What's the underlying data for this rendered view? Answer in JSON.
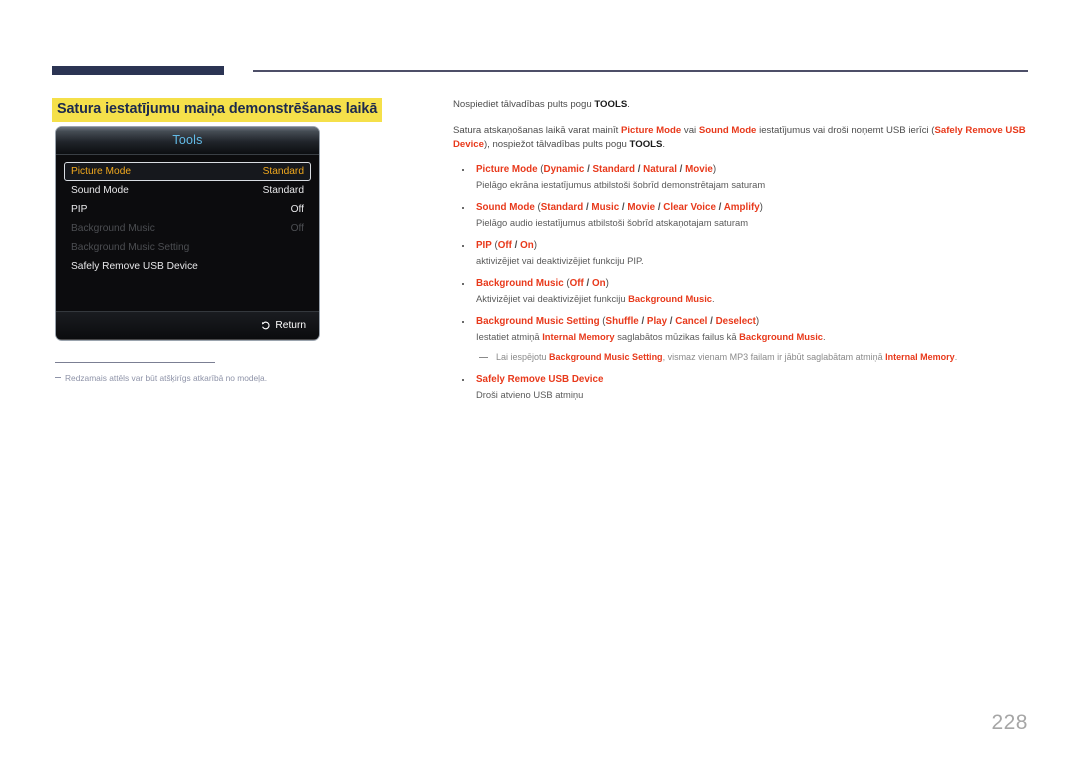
{
  "page": {
    "number": "228"
  },
  "section": {
    "title": "Satura iestatījumu maiņa demonstrēšanas laikā"
  },
  "osd": {
    "title": "Tools",
    "rows": [
      {
        "label": "Picture Mode",
        "value": "Standard",
        "state": "selected"
      },
      {
        "label": "Sound Mode",
        "value": "Standard",
        "state": "normal"
      },
      {
        "label": "PIP",
        "value": "Off",
        "state": "normal"
      },
      {
        "label": "Background Music",
        "value": "Off",
        "state": "disabled"
      },
      {
        "label": "Background Music Setting",
        "value": "",
        "state": "disabled"
      },
      {
        "label": "Safely Remove USB Device",
        "value": "",
        "state": "normal"
      }
    ],
    "return_label": "Return",
    "return_icon": "return-arrow-icon"
  },
  "footnote": {
    "text": "Redzamais attēls var būt atšķirīgs atkarībā no modeļa."
  },
  "body": {
    "paragraph1": {
      "pre": "Nospiediet tālvadības pults pogu ",
      "bold1": "TOOLS",
      "post": "."
    },
    "paragraph2": {
      "p1": "Satura atskaņošanas laikā varat mainīt ",
      "kw1": "Picture Mode",
      "p2": " vai ",
      "kw2": "Sound Mode",
      "p3": " iestatījumus vai droši noņemt USB ierīci (",
      "kw3": "Safely Remove USB Device",
      "p4": "), nospiežot tālvadības pults pogu ",
      "bold1": "TOOLS",
      "p5": "."
    },
    "bullets": [
      {
        "name": "Picture Mode",
        "options": [
          "Dynamic",
          "Standard",
          "Natural",
          "Movie"
        ],
        "desc": "Pielāgo ekrāna iestatījumus atbilstoši šobrīd demonstrētajam saturam"
      },
      {
        "name": "Sound Mode",
        "options": [
          "Standard",
          "Music",
          "Movie",
          "Clear Voice",
          "Amplify"
        ],
        "desc": "Pielāgo audio iestatījumus atbilstoši šobrīd atskaņotajam saturam"
      },
      {
        "name": "PIP",
        "options": [
          "Off",
          "On"
        ],
        "desc": "aktivizējiet vai deaktivizējiet funkciju PIP."
      },
      {
        "name": "Background Music",
        "options": [
          "Off",
          "On"
        ],
        "desc_pre": "Aktivizējiet vai deaktivizējiet funkciju ",
        "desc_kw": "Background Music",
        "desc_post": "."
      },
      {
        "name": "Background Music Setting",
        "options": [
          "Shuffle",
          "Play",
          "Cancel",
          "Deselect"
        ],
        "desc_pre": "Iestatiet atmiņā ",
        "desc_kw1": "Internal Memory",
        "desc_mid": " saglabātos mūzikas failus kā ",
        "desc_kw2": "Background Music",
        "desc_post": "."
      },
      {
        "name": "Safely Remove USB Device",
        "options": [],
        "desc": "Droši atvieno USB atmiņu"
      }
    ],
    "subnote": {
      "pre": "Lai iespējotu ",
      "kw1": "Background Music Setting",
      "mid": ", vismaz vienam MP3 failam ir jābūt saglabātam atmiņā ",
      "kw2": "Internal Memory",
      "post": "."
    }
  }
}
